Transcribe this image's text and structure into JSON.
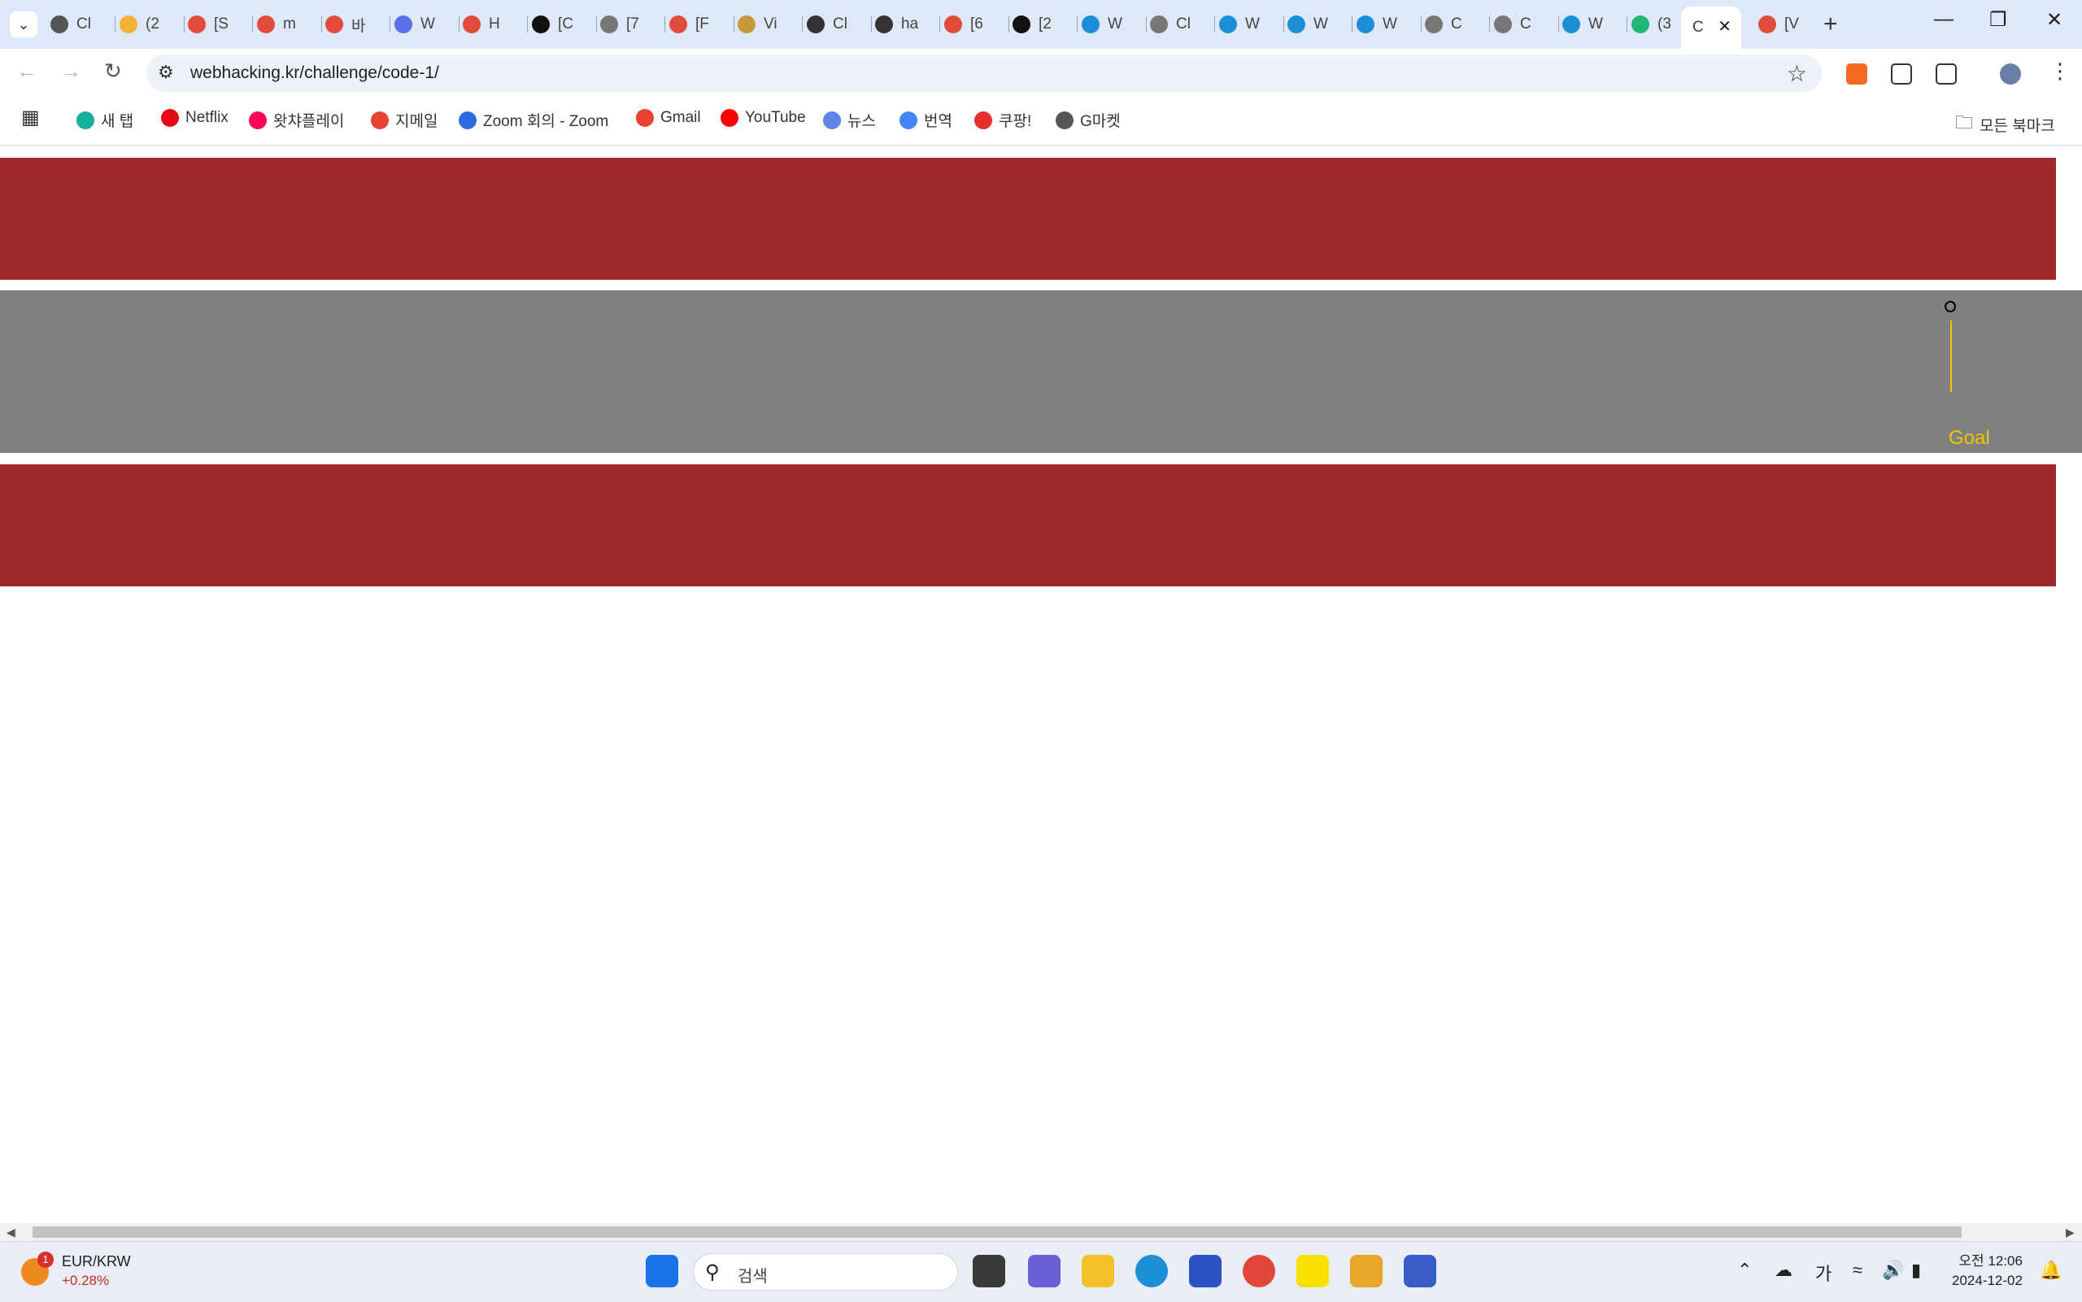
{
  "tabs": [
    {
      "label": "Cl",
      "favicon_color": "#555555"
    },
    {
      "label": "(2",
      "favicon_color": "#f2b233"
    },
    {
      "label": "[S",
      "favicon_color": "#e24a3b"
    },
    {
      "label": "m",
      "favicon_color": "#e24a3b"
    },
    {
      "label": "바",
      "favicon_color": "#e24a3b"
    },
    {
      "label": "W",
      "favicon_color": "#5b6de8"
    },
    {
      "label": "H",
      "favicon_color": "#e24a3b"
    },
    {
      "label": "[C",
      "favicon_color": "#111111"
    },
    {
      "label": "[7",
      "favicon_color": "#777777"
    },
    {
      "label": "[F",
      "favicon_color": "#e24a3b"
    },
    {
      "label": "Vi",
      "favicon_color": "#c49a3a"
    },
    {
      "label": "Cl",
      "favicon_color": "#333333"
    },
    {
      "label": "ha",
      "favicon_color": "#333333"
    },
    {
      "label": "[6",
      "favicon_color": "#e24a3b"
    },
    {
      "label": "[2",
      "favicon_color": "#111111"
    },
    {
      "label": "W",
      "favicon_color": "#1a8fd8"
    },
    {
      "label": "Cl",
      "favicon_color": "#777777"
    },
    {
      "label": "W",
      "favicon_color": "#1a8fd8"
    },
    {
      "label": "W",
      "favicon_color": "#1a8fd8"
    },
    {
      "label": "W",
      "favicon_color": "#1a8fd8"
    },
    {
      "label": "C",
      "favicon_color": "#777777"
    },
    {
      "label": "C",
      "favicon_color": "#777777"
    },
    {
      "label": "W",
      "favicon_color": "#1a8fd8"
    },
    {
      "label": "(3",
      "favicon_color": "#22b573"
    }
  ],
  "active_tab": {
    "label": "C"
  },
  "last_tab": {
    "label": "[V",
    "favicon_color": "#e24a3b"
  },
  "address_bar": {
    "url": "webhacking.kr/challenge/code-1/"
  },
  "bookmarks": [
    {
      "label": "새 탭",
      "icon": "m-circle-icon",
      "color": "#1aae9f"
    },
    {
      "label": "Netflix",
      "icon": "netflix-icon",
      "color": "#e50914"
    },
    {
      "label": "왓챠플레이",
      "icon": "watcha-icon",
      "color": "#ff0558"
    },
    {
      "label": "지메일",
      "icon": "gmail-icon",
      "color": "#ea4335"
    },
    {
      "label": "Zoom 회의 - Zoom",
      "icon": "zoom-icon",
      "color": "#2d6cdf"
    },
    {
      "label": "Gmail",
      "icon": "gmail-icon",
      "color": "#ea4335"
    },
    {
      "label": "YouTube",
      "icon": "youtube-icon",
      "color": "#ff0000"
    },
    {
      "label": "뉴스",
      "icon": "news-icon",
      "color": "#5b86e5"
    },
    {
      "label": "번역",
      "icon": "translate-icon",
      "color": "#4285f4"
    },
    {
      "label": "쿠팡!",
      "icon": "coupang-icon",
      "color": "#e8302a"
    },
    {
      "label": "G마켓",
      "icon": "globe-icon",
      "color": "#555555"
    }
  ],
  "all_bookmarks": {
    "label": "모든 북마크"
  },
  "game": {
    "goal_label": "Goal",
    "ball_symbol": "o",
    "band_color": "#a1292a",
    "track_color": "#808080",
    "goal_color": "#f0c500"
  },
  "taskbar": {
    "widget": {
      "name": "EUR/KRW",
      "value": "+0.28%",
      "badge": "1"
    },
    "search_placeholder": "검색",
    "ime": "가",
    "time": "오전 12:06",
    "date": "2024-12-02"
  }
}
